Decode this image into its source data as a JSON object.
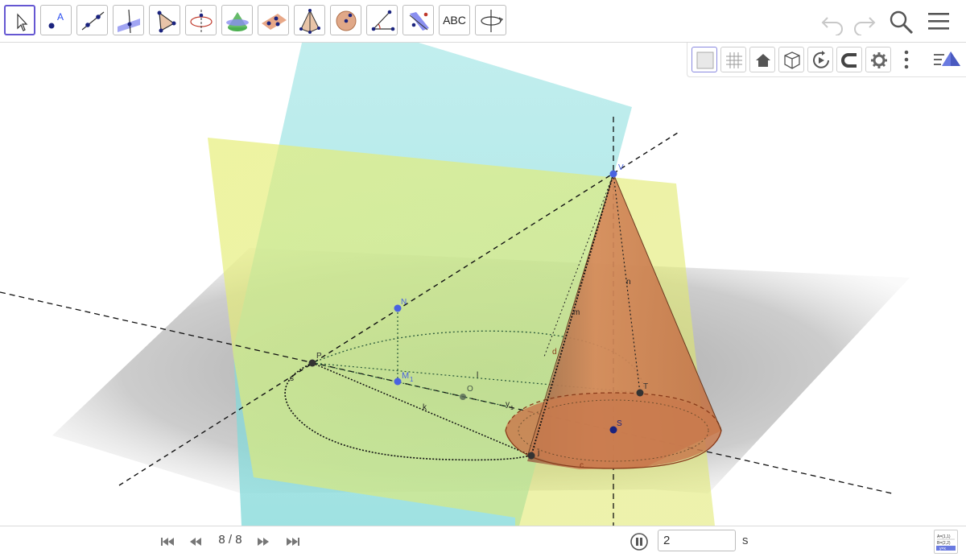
{
  "toolbar": {
    "tools": [
      {
        "name": "move-tool"
      },
      {
        "name": "point-tool"
      },
      {
        "name": "line-tool"
      },
      {
        "name": "perpendicular-line-tool"
      },
      {
        "name": "polygon-tool"
      },
      {
        "name": "circle-axis-point-tool"
      },
      {
        "name": "cone-tool"
      },
      {
        "name": "plane-through-points-tool"
      },
      {
        "name": "pyramid-tool"
      },
      {
        "name": "sphere-tool"
      },
      {
        "name": "angle-tool"
      },
      {
        "name": "reflect-tool"
      },
      {
        "name": "text-tool",
        "label": "ABC"
      },
      {
        "name": "rotate-view-tool"
      }
    ],
    "undo_icon": "undo-icon",
    "redo_icon": "redo-icon",
    "search_icon": "search-icon",
    "menu_icon": "menu-icon"
  },
  "style_bar": {
    "buttons": [
      "background-color",
      "grid",
      "home",
      "view-cube",
      "rotate-animation",
      "magnet",
      "settings",
      "more",
      "graphics-3d"
    ]
  },
  "graphics": {
    "labels": {
      "V": "V",
      "P": "P",
      "M1": "M",
      "M1_sub": "1",
      "N": "N",
      "O": "O",
      "S": "S",
      "T": "T",
      "y1": "y",
      "y1_sub": "1",
      "n": "n",
      "m": "m",
      "d": "d",
      "l": "l",
      "k": "k",
      "c": "c",
      "s": "s",
      "j": "j"
    },
    "colors": {
      "cone": "#c97a4e",
      "cyan_plane": "#7fd8d8",
      "yellow_plane": "#e4eb74",
      "ground_plane": "#8a8a8a",
      "point_blue": "#4a63e0",
      "point_dark": "#333333"
    }
  },
  "playback": {
    "slide_counter": "8 / 8",
    "speed_value": "2",
    "speed_unit": "s",
    "buttons": [
      "first-slide",
      "previous-slide",
      "next-slide",
      "last-slide",
      "pause"
    ]
  },
  "algebra_toggle": {
    "line1": "A=(1,1)",
    "line2": "B=(2,2)",
    "line3": "y=x"
  }
}
